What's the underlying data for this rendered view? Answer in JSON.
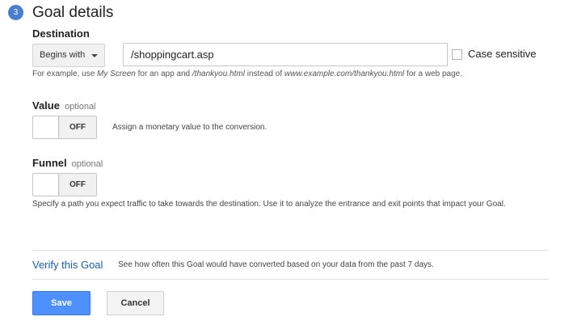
{
  "header": {
    "step_number": "3",
    "title": "Goal details"
  },
  "destination": {
    "label": "Destination",
    "match_type": "Begins with",
    "value": "/shoppingcart.asp",
    "case_sensitive_label": "Case sensitive",
    "case_sensitive_checked": false,
    "hint": {
      "t1": "For example, use ",
      "e1": "My Screen",
      "t2": " for an app and ",
      "e2": "/thankyou.html",
      "t3": " instead of ",
      "e3": "www.example.com/thankyou.html",
      "t4": " for a web page."
    }
  },
  "value_section": {
    "label": "Value",
    "optional": "optional",
    "toggle_state": "OFF",
    "description": "Assign a monetary value to the conversion."
  },
  "funnel_section": {
    "label": "Funnel",
    "optional": "optional",
    "toggle_state": "OFF",
    "description": "Specify a path you expect traffic to take towards the destination. Use it to analyze the entrance and exit points that impact your Goal."
  },
  "verify": {
    "link": "Verify this Goal",
    "description": "See how often this Goal would have converted based on your data from the past 7 days."
  },
  "actions": {
    "save": "Save",
    "cancel": "Cancel"
  },
  "colors": {
    "accent": "#4d90fe",
    "link": "#1a5ea8",
    "badge": "#4a7fd0"
  }
}
